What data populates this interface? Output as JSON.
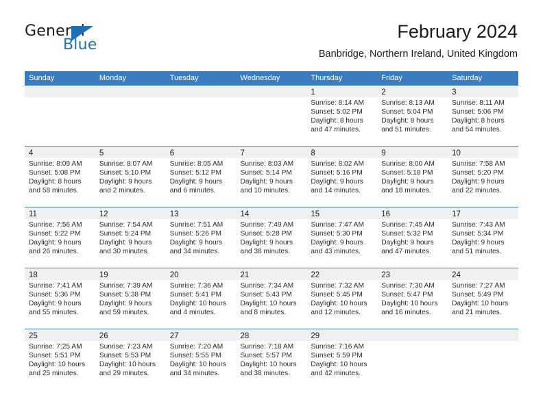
{
  "brand": {
    "name_top": "General",
    "name_bottom": "Blue",
    "triangle_icon": "triangle-icon",
    "accent_color": "#2072b8"
  },
  "header": {
    "title": "February 2024",
    "subtitle": "Banbridge, Northern Ireland, United Kingdom"
  },
  "colors": {
    "header_blue": "#3a7cbd",
    "daynum_band": "#f0f0f0",
    "text": "#1b1b1b"
  },
  "weekdays": [
    "Sunday",
    "Monday",
    "Tuesday",
    "Wednesday",
    "Thursday",
    "Friday",
    "Saturday"
  ],
  "weeks": [
    [
      {
        "day": "",
        "sunrise": "",
        "sunset": "",
        "daylight1": "",
        "daylight2": ""
      },
      {
        "day": "",
        "sunrise": "",
        "sunset": "",
        "daylight1": "",
        "daylight2": ""
      },
      {
        "day": "",
        "sunrise": "",
        "sunset": "",
        "daylight1": "",
        "daylight2": ""
      },
      {
        "day": "",
        "sunrise": "",
        "sunset": "",
        "daylight1": "",
        "daylight2": ""
      },
      {
        "day": "1",
        "sunrise": "Sunrise: 8:14 AM",
        "sunset": "Sunset: 5:02 PM",
        "daylight1": "Daylight: 8 hours",
        "daylight2": "and 47 minutes."
      },
      {
        "day": "2",
        "sunrise": "Sunrise: 8:13 AM",
        "sunset": "Sunset: 5:04 PM",
        "daylight1": "Daylight: 8 hours",
        "daylight2": "and 51 minutes."
      },
      {
        "day": "3",
        "sunrise": "Sunrise: 8:11 AM",
        "sunset": "Sunset: 5:06 PM",
        "daylight1": "Daylight: 8 hours",
        "daylight2": "and 54 minutes."
      }
    ],
    [
      {
        "day": "4",
        "sunrise": "Sunrise: 8:09 AM",
        "sunset": "Sunset: 5:08 PM",
        "daylight1": "Daylight: 8 hours",
        "daylight2": "and 58 minutes."
      },
      {
        "day": "5",
        "sunrise": "Sunrise: 8:07 AM",
        "sunset": "Sunset: 5:10 PM",
        "daylight1": "Daylight: 9 hours",
        "daylight2": "and 2 minutes."
      },
      {
        "day": "6",
        "sunrise": "Sunrise: 8:05 AM",
        "sunset": "Sunset: 5:12 PM",
        "daylight1": "Daylight: 9 hours",
        "daylight2": "and 6 minutes."
      },
      {
        "day": "7",
        "sunrise": "Sunrise: 8:03 AM",
        "sunset": "Sunset: 5:14 PM",
        "daylight1": "Daylight: 9 hours",
        "daylight2": "and 10 minutes."
      },
      {
        "day": "8",
        "sunrise": "Sunrise: 8:02 AM",
        "sunset": "Sunset: 5:16 PM",
        "daylight1": "Daylight: 9 hours",
        "daylight2": "and 14 minutes."
      },
      {
        "day": "9",
        "sunrise": "Sunrise: 8:00 AM",
        "sunset": "Sunset: 5:18 PM",
        "daylight1": "Daylight: 9 hours",
        "daylight2": "and 18 minutes."
      },
      {
        "day": "10",
        "sunrise": "Sunrise: 7:58 AM",
        "sunset": "Sunset: 5:20 PM",
        "daylight1": "Daylight: 9 hours",
        "daylight2": "and 22 minutes."
      }
    ],
    [
      {
        "day": "11",
        "sunrise": "Sunrise: 7:56 AM",
        "sunset": "Sunset: 5:22 PM",
        "daylight1": "Daylight: 9 hours",
        "daylight2": "and 26 minutes."
      },
      {
        "day": "12",
        "sunrise": "Sunrise: 7:54 AM",
        "sunset": "Sunset: 5:24 PM",
        "daylight1": "Daylight: 9 hours",
        "daylight2": "and 30 minutes."
      },
      {
        "day": "13",
        "sunrise": "Sunrise: 7:51 AM",
        "sunset": "Sunset: 5:26 PM",
        "daylight1": "Daylight: 9 hours",
        "daylight2": "and 34 minutes."
      },
      {
        "day": "14",
        "sunrise": "Sunrise: 7:49 AM",
        "sunset": "Sunset: 5:28 PM",
        "daylight1": "Daylight: 9 hours",
        "daylight2": "and 38 minutes."
      },
      {
        "day": "15",
        "sunrise": "Sunrise: 7:47 AM",
        "sunset": "Sunset: 5:30 PM",
        "daylight1": "Daylight: 9 hours",
        "daylight2": "and 43 minutes."
      },
      {
        "day": "16",
        "sunrise": "Sunrise: 7:45 AM",
        "sunset": "Sunset: 5:32 PM",
        "daylight1": "Daylight: 9 hours",
        "daylight2": "and 47 minutes."
      },
      {
        "day": "17",
        "sunrise": "Sunrise: 7:43 AM",
        "sunset": "Sunset: 5:34 PM",
        "daylight1": "Daylight: 9 hours",
        "daylight2": "and 51 minutes."
      }
    ],
    [
      {
        "day": "18",
        "sunrise": "Sunrise: 7:41 AM",
        "sunset": "Sunset: 5:36 PM",
        "daylight1": "Daylight: 9 hours",
        "daylight2": "and 55 minutes."
      },
      {
        "day": "19",
        "sunrise": "Sunrise: 7:39 AM",
        "sunset": "Sunset: 5:38 PM",
        "daylight1": "Daylight: 9 hours",
        "daylight2": "and 59 minutes."
      },
      {
        "day": "20",
        "sunrise": "Sunrise: 7:36 AM",
        "sunset": "Sunset: 5:41 PM",
        "daylight1": "Daylight: 10 hours",
        "daylight2": "and 4 minutes."
      },
      {
        "day": "21",
        "sunrise": "Sunrise: 7:34 AM",
        "sunset": "Sunset: 5:43 PM",
        "daylight1": "Daylight: 10 hours",
        "daylight2": "and 8 minutes."
      },
      {
        "day": "22",
        "sunrise": "Sunrise: 7:32 AM",
        "sunset": "Sunset: 5:45 PM",
        "daylight1": "Daylight: 10 hours",
        "daylight2": "and 12 minutes."
      },
      {
        "day": "23",
        "sunrise": "Sunrise: 7:30 AM",
        "sunset": "Sunset: 5:47 PM",
        "daylight1": "Daylight: 10 hours",
        "daylight2": "and 16 minutes."
      },
      {
        "day": "24",
        "sunrise": "Sunrise: 7:27 AM",
        "sunset": "Sunset: 5:49 PM",
        "daylight1": "Daylight: 10 hours",
        "daylight2": "and 21 minutes."
      }
    ],
    [
      {
        "day": "25",
        "sunrise": "Sunrise: 7:25 AM",
        "sunset": "Sunset: 5:51 PM",
        "daylight1": "Daylight: 10 hours",
        "daylight2": "and 25 minutes."
      },
      {
        "day": "26",
        "sunrise": "Sunrise: 7:23 AM",
        "sunset": "Sunset: 5:53 PM",
        "daylight1": "Daylight: 10 hours",
        "daylight2": "and 29 minutes."
      },
      {
        "day": "27",
        "sunrise": "Sunrise: 7:20 AM",
        "sunset": "Sunset: 5:55 PM",
        "daylight1": "Daylight: 10 hours",
        "daylight2": "and 34 minutes."
      },
      {
        "day": "28",
        "sunrise": "Sunrise: 7:18 AM",
        "sunset": "Sunset: 5:57 PM",
        "daylight1": "Daylight: 10 hours",
        "daylight2": "and 38 minutes."
      },
      {
        "day": "29",
        "sunrise": "Sunrise: 7:16 AM",
        "sunset": "Sunset: 5:59 PM",
        "daylight1": "Daylight: 10 hours",
        "daylight2": "and 42 minutes."
      },
      {
        "day": "",
        "sunrise": "",
        "sunset": "",
        "daylight1": "",
        "daylight2": ""
      },
      {
        "day": "",
        "sunrise": "",
        "sunset": "",
        "daylight1": "",
        "daylight2": ""
      }
    ]
  ]
}
